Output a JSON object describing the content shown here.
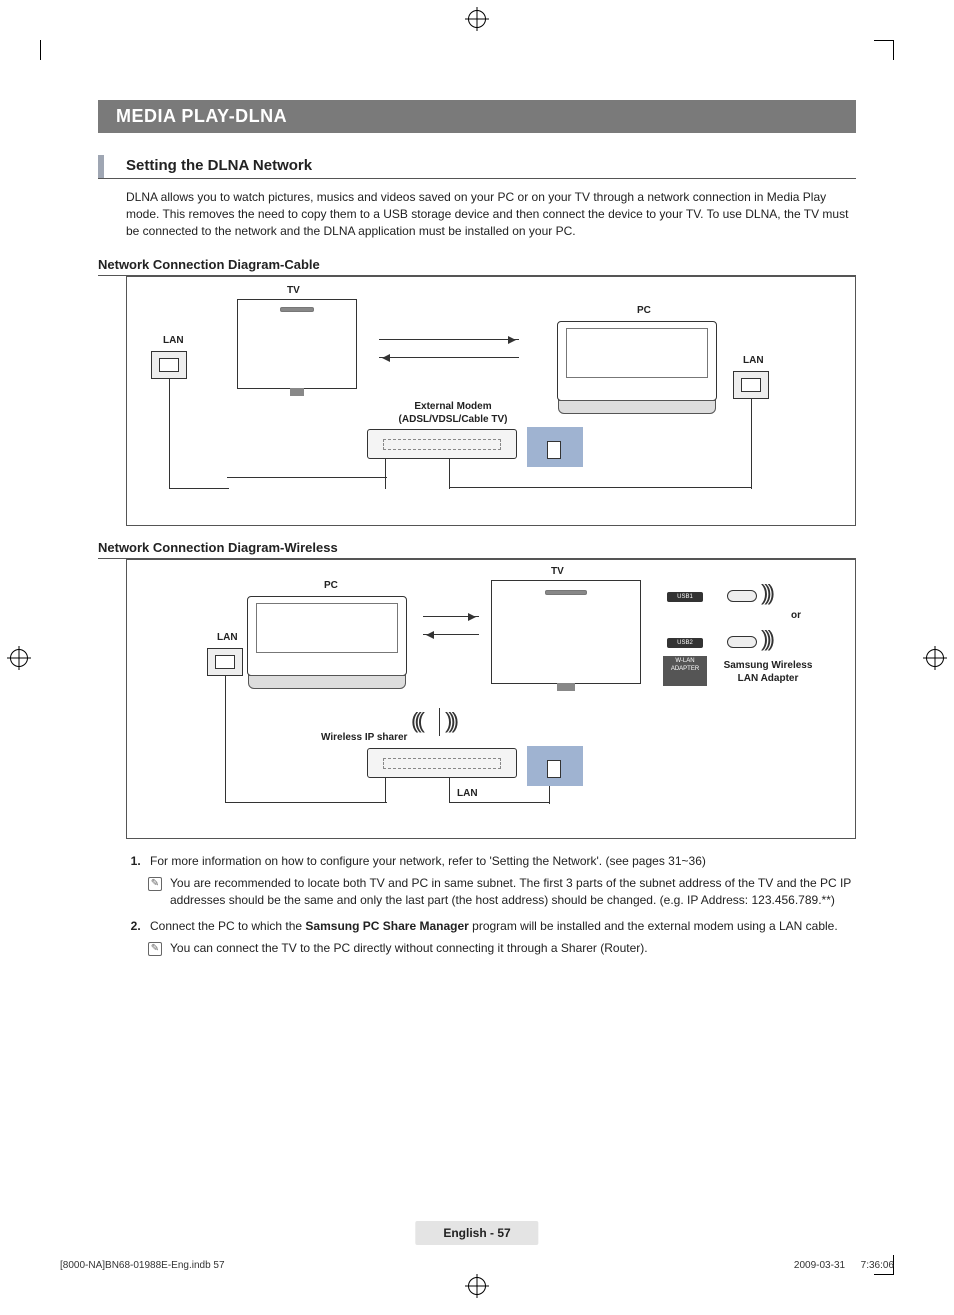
{
  "chapter_title": "MEDIA PLAY-DLNA",
  "section_title": "Setting the DLNA Network",
  "intro_paragraph": "DLNA allows you to watch pictures, musics and videos saved on your PC or on your TV through a network connection in Media Play mode. This removes the need to copy them to a USB storage device and then connect the device to your TV. To use DLNA, the TV must be connected to the network and the DLNA application must be installed on your PC.",
  "diagram1": {
    "heading": "Network Connection Diagram-Cable",
    "labels": {
      "tv": "TV",
      "pc": "PC",
      "lan_left": "LAN",
      "lan_right": "LAN",
      "modem_line1": "External Modem",
      "modem_line2": "(ADSL/VDSL/Cable TV)"
    }
  },
  "diagram2": {
    "heading": "Network Connection Diagram-Wireless",
    "labels": {
      "tv": "TV",
      "pc": "PC",
      "lan_left": "LAN",
      "lan_bottom": "LAN",
      "or": "or",
      "adapter_line1": "Samsung Wireless",
      "adapter_line2": "LAN Adapter",
      "sharer": "Wireless IP sharer"
    }
  },
  "steps": [
    {
      "num": "1.",
      "text_before": "For more information on how to configure your network, refer to 'Setting the Network'. (see pages 31~36)",
      "notes": [
        "You are recommended to locate both TV and PC in same subnet. The first 3 parts of the subnet address of the TV and the PC IP addresses should be the same and only the last part (the host address) should be changed. (e.g. IP Address: 123.456.789.**)"
      ]
    },
    {
      "num": "2.",
      "text_before": "Connect the PC to which the ",
      "bold_mid": "Samsung PC Share Manager",
      "text_after": " program will be installed and the external modem using a LAN cable.",
      "notes": [
        "You can connect the TV to the PC directly without connecting it through a Sharer (Router)."
      ]
    }
  ],
  "page_footer": {
    "page_label": "English - 57",
    "doc_name": "[8000-NA]BN68-01988E-Eng.indb   57",
    "timestamp": "2009-03-31      7:36:06"
  }
}
